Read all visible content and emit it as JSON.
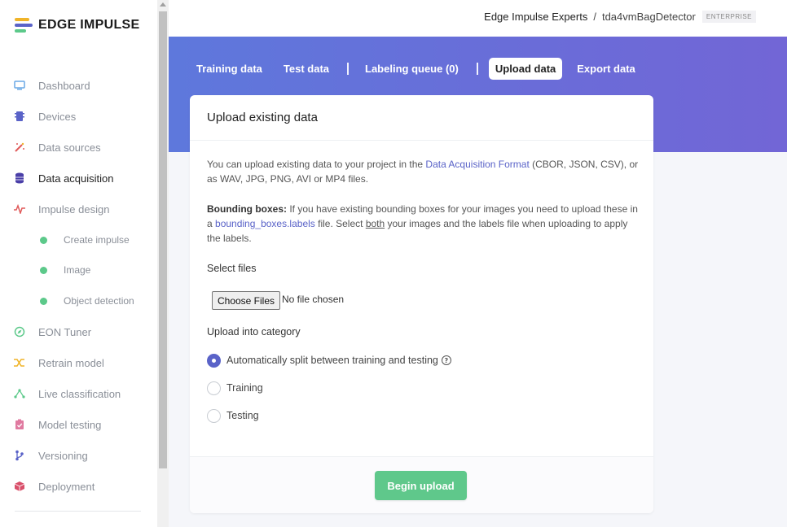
{
  "brand": {
    "name": "EDGE IMPULSE"
  },
  "sidebar": {
    "items": [
      {
        "label": "Dashboard",
        "icon": "monitor-icon",
        "color": "#6aa9e6"
      },
      {
        "label": "Devices",
        "icon": "chip-icon",
        "color": "#5a63c8"
      },
      {
        "label": "Data sources",
        "icon": "magic-wand-icon",
        "color": "#e05a5a"
      },
      {
        "label": "Data acquisition",
        "icon": "database-icon",
        "color": "#4a3fa8"
      },
      {
        "label": "Impulse design",
        "icon": "pulse-icon",
        "color": "#e05a5a"
      },
      {
        "label": "Create impulse",
        "sub": true
      },
      {
        "label": "Image",
        "sub": true
      },
      {
        "label": "Object detection",
        "sub": true
      },
      {
        "label": "EON Tuner",
        "icon": "compass-icon",
        "color": "#5cc98a"
      },
      {
        "label": "Retrain model",
        "icon": "shuffle-icon",
        "color": "#f0b429"
      },
      {
        "label": "Live classification",
        "icon": "network-icon",
        "color": "#5cc98a"
      },
      {
        "label": "Model testing",
        "icon": "clipboard-check-icon",
        "color": "#e07aa0"
      },
      {
        "label": "Versioning",
        "icon": "branch-icon",
        "color": "#5a63c8"
      },
      {
        "label": "Deployment",
        "icon": "package-icon",
        "color": "#d94f6a"
      }
    ]
  },
  "breadcrumb": {
    "org": "Edge Impulse Experts",
    "separator": "/",
    "project": "tda4vmBagDetector",
    "badge": "ENTERPRISE"
  },
  "tabs": {
    "training": "Training data",
    "test": "Test data",
    "labeling": "Labeling queue (0)",
    "upload": "Upload data",
    "export": "Export data"
  },
  "card": {
    "title": "Upload existing data",
    "intro_prefix": "You can upload existing data to your project in the ",
    "intro_link": "Data Acquisition Format",
    "intro_suffix": " (CBOR, JSON, CSV), or as WAV, JPG, PNG, AVI or MP4 files.",
    "bbox_bold": "Bounding boxes:",
    "bbox_text1": " If you have existing bounding boxes for your images you need to upload these in a ",
    "bbox_link": "bounding_boxes.labels",
    "bbox_text2": " file. Select ",
    "bbox_underline": "both",
    "bbox_text3": " your images and the labels file when uploading to apply the labels.",
    "select_files_label": "Select files",
    "choose_files_button": "Choose Files",
    "file_status": "No file chosen",
    "category_label": "Upload into category",
    "options": [
      {
        "label": "Automatically split between training and testing",
        "checked": true
      },
      {
        "label": "Training",
        "checked": false
      },
      {
        "label": "Testing",
        "checked": false
      }
    ],
    "help_glyph": "?",
    "begin_button": "Begin upload"
  },
  "colors": {
    "accent": "#5a63c8",
    "header_gradient_start": "#5e78dc",
    "header_gradient_end": "#7266d6",
    "success": "#5fc88b"
  }
}
